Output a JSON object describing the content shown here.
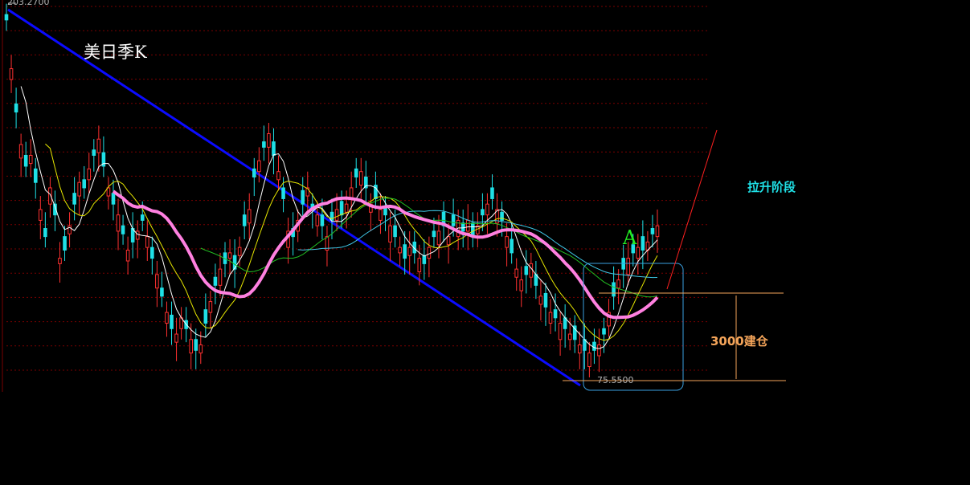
{
  "annotations": {
    "title": "美日季K",
    "stage_label": "拉升阶段",
    "point_label": "A",
    "position_label": "3000建仓",
    "high_label": "203.2700",
    "low_label": "75.5500"
  },
  "colors": {
    "up": "#ff3030",
    "down": "#1fe0e6",
    "trendline": "#0b0bff",
    "ma_long": "#ff80e0",
    "ma_short": "#ffffff",
    "ma_mid": "#e6e600",
    "ma_green": "#22c022",
    "ma_cyan": "#40c8e8",
    "orange": "#f5a55a",
    "box": "#3aa0e0",
    "arrow": "#ff2020",
    "grid": "#7a0000"
  },
  "chart_data": {
    "type": "candlestick",
    "title": "美日季K",
    "y_max_label": 203.27,
    "y_min_label": 75.55,
    "ylim": [
      68,
      205
    ],
    "count": 140,
    "grid": true,
    "closes": [
      200,
      182,
      166,
      154,
      146,
      150,
      140,
      130,
      120,
      138,
      128,
      112,
      115,
      124,
      132,
      140,
      138,
      145,
      150,
      156,
      146,
      138,
      132,
      128,
      121,
      115,
      118,
      122,
      126,
      120,
      112,
      106,
      98,
      92,
      86,
      84,
      90,
      86,
      82,
      78,
      80,
      88,
      96,
      102,
      108,
      110,
      114,
      108,
      116,
      124,
      130,
      142,
      148,
      153,
      158,
      150,
      144,
      134,
      122,
      120,
      126,
      132,
      138,
      130,
      128,
      124,
      120,
      126,
      130,
      128,
      132,
      138,
      142,
      144,
      138,
      132,
      134,
      130,
      128,
      124,
      120,
      116,
      112,
      116,
      114,
      112,
      110,
      116,
      120,
      122,
      124,
      120,
      124,
      126,
      122,
      126,
      120,
      124,
      128,
      132,
      134,
      130,
      126,
      120,
      114,
      108,
      104,
      106,
      110,
      102,
      98,
      94,
      92,
      90,
      88,
      86,
      84,
      82,
      80,
      78,
      77,
      78,
      80,
      84,
      92,
      98,
      104,
      108,
      112,
      114,
      116,
      115,
      118,
      121,
      124
    ],
    "opens_offset": [
      2,
      -4,
      3,
      -5,
      4,
      -3,
      5,
      -4,
      3,
      -6,
      4,
      -2,
      5,
      -3,
      4,
      -5,
      3,
      -4,
      2,
      -5,
      5,
      -3,
      4,
      -6,
      3,
      -4,
      5,
      -3,
      2,
      -4,
      4,
      -5,
      3,
      -4,
      5,
      -3,
      -4,
      3,
      -5,
      4,
      -3,
      5,
      -4,
      3,
      -6,
      4,
      -2,
      5,
      -3,
      4,
      -5,
      3,
      -4,
      2,
      -5,
      5,
      -3,
      4,
      -6,
      3,
      -4,
      5,
      -3,
      2,
      -4,
      4,
      -5,
      3,
      -4,
      5,
      -3,
      -4,
      3,
      -5,
      4,
      -3,
      5,
      -4,
      3,
      -6,
      4,
      -2,
      5,
      -3,
      4,
      -5,
      3,
      -4,
      2,
      -5,
      5,
      -3,
      4,
      -6,
      3,
      -4,
      5,
      -3,
      2,
      -4,
      4,
      -5,
      3,
      -4,
      5,
      -3,
      -4,
      3,
      -5,
      4,
      -3,
      5,
      -4,
      3,
      -6,
      4,
      -2,
      5,
      -3,
      4,
      -5,
      3,
      -4,
      2,
      -5,
      5,
      -3,
      4,
      -6,
      3,
      -4,
      5,
      -3,
      2,
      -4,
      4,
      -5,
      3,
      -4,
      5,
      -3,
      -4,
      3,
      -5
    ]
  }
}
